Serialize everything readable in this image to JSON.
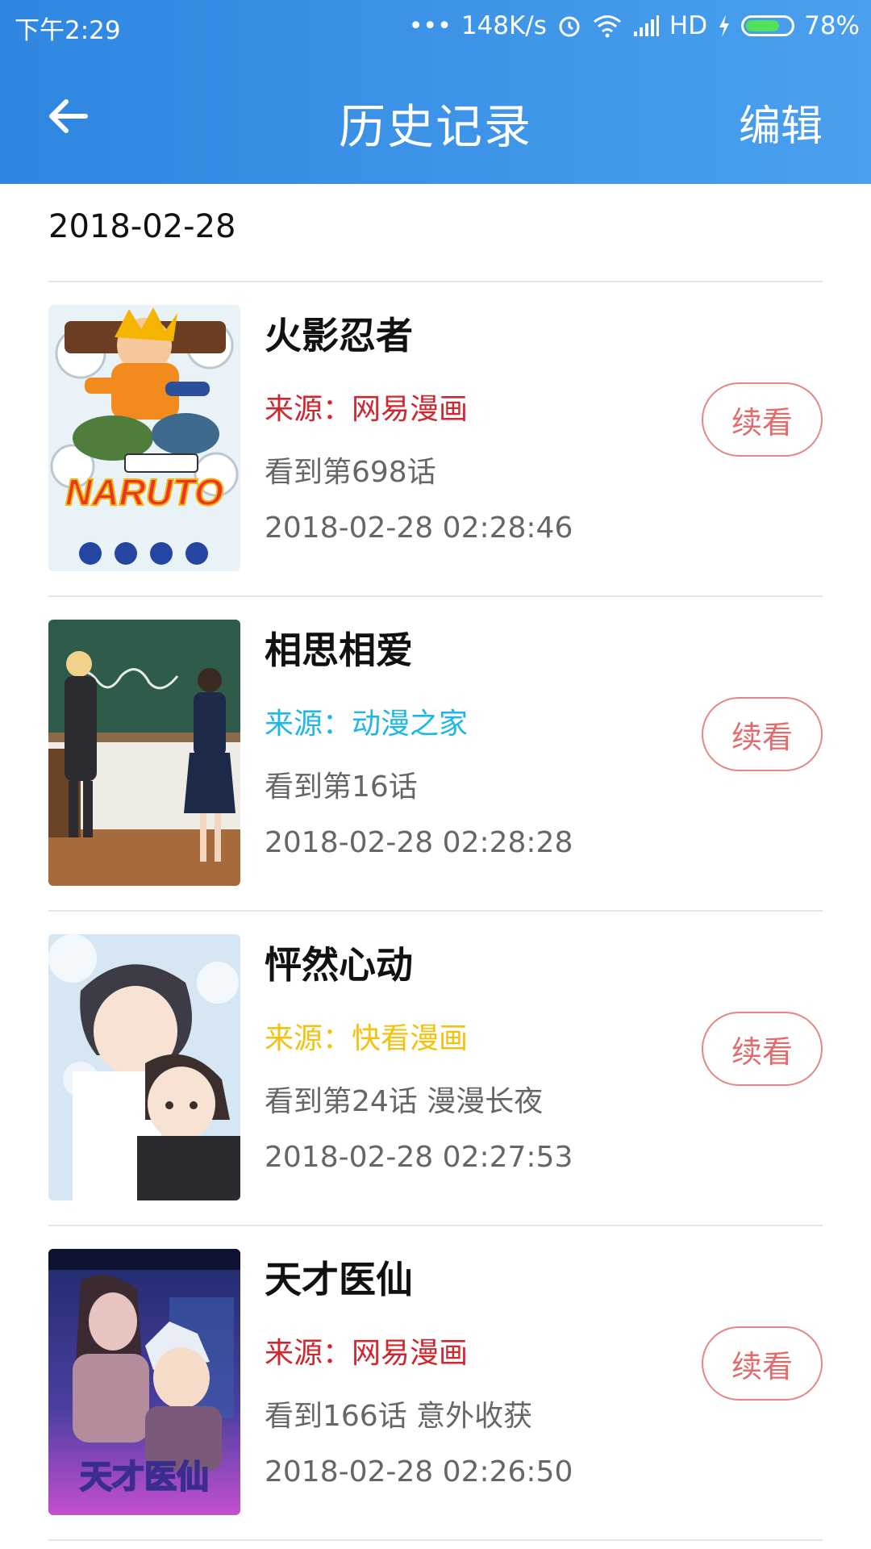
{
  "status_bar": {
    "time": "下午2:29",
    "dots": "•••",
    "speed": "148K/s",
    "network": "HD",
    "battery_percent": "78%",
    "battery_level": 0.78,
    "icons": [
      "alarm-icon",
      "wifi-icon",
      "signal-icon",
      "charging-icon",
      "battery-icon"
    ]
  },
  "header": {
    "title": "历史记录",
    "edit_label": "编辑",
    "background": "#3a92e8"
  },
  "date_group": "2018-02-28",
  "history": [
    {
      "title": "火影忍者",
      "source": "来源：网易漫画",
      "source_color": "#d0262f",
      "progress": "看到第698话",
      "time": "2018-02-28 02:28:46",
      "action": "续看",
      "cover_text": "NARUTO"
    },
    {
      "title": "相思相爱",
      "source": "来源：动漫之家",
      "source_color": "#1fb6e8",
      "progress": "看到第16话",
      "time": "2018-02-28 02:28:28",
      "action": "续看"
    },
    {
      "title": "怦然心动",
      "source": "来源：快看漫画",
      "source_color": "#f3c20f",
      "progress": "看到第24话 漫漫长夜",
      "time": "2018-02-28 02:27:53",
      "action": "续看"
    },
    {
      "title": "天才医仙",
      "source": "来源：网易漫画",
      "source_color": "#d0262f",
      "progress": "看到166话 意外收获",
      "time": "2018-02-28 02:26:50",
      "action": "续看",
      "cover_text": "天才医仙"
    }
  ]
}
